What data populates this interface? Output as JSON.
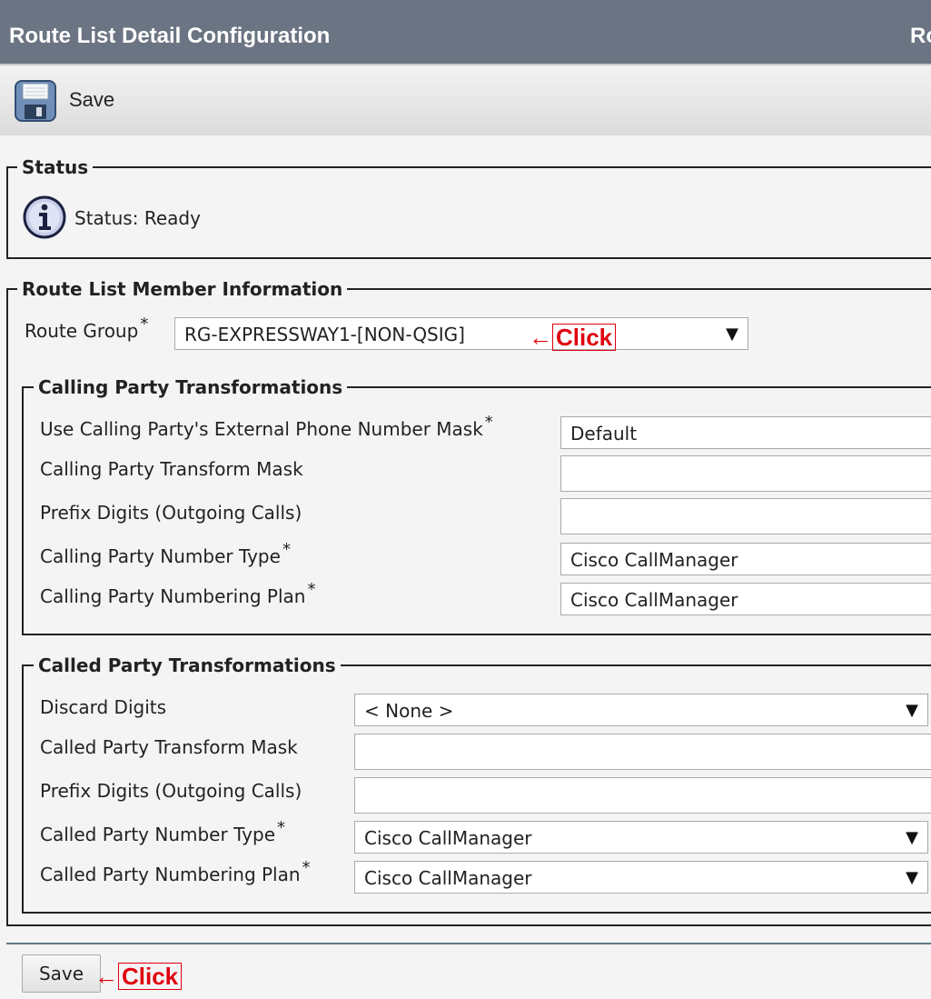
{
  "header": {
    "title": "Route List Detail Configuration",
    "right_text": "Ro"
  },
  "toolbar": {
    "save_label": "Save"
  },
  "status_section": {
    "legend": "Status",
    "text": "Status: Ready"
  },
  "member_section": {
    "legend": "Route List Member Information",
    "route_group": {
      "label": "Route Group",
      "required": "*",
      "value": "RG-EXPRESSWAY1-[NON-QSIG]"
    }
  },
  "calling_section": {
    "legend": "Calling Party Transformations",
    "fields": [
      {
        "label": "Use Calling Party's External Phone Number Mask",
        "required": "*",
        "value": "Default"
      },
      {
        "label": "Calling Party Transform Mask",
        "value": ""
      },
      {
        "label": "Prefix Digits (Outgoing Calls)",
        "value": ""
      },
      {
        "label": "Calling Party Number Type",
        "required": "*",
        "value": "Cisco CallManager"
      },
      {
        "label": "Calling Party Numbering Plan",
        "required": "*",
        "value": "Cisco CallManager"
      }
    ]
  },
  "called_section": {
    "legend": "Called Party Transformations",
    "fields": [
      {
        "label": "Discard Digits",
        "value": "< None >"
      },
      {
        "label": "Called Party Transform Mask",
        "value": ""
      },
      {
        "label": "Prefix Digits (Outgoing Calls)",
        "value": ""
      },
      {
        "label": "Called Party Number Type",
        "required": "*",
        "value": "Cisco CallManager"
      },
      {
        "label": "Called Party Numbering Plan",
        "required": "*",
        "value": "Cisco CallManager"
      }
    ]
  },
  "annotations": {
    "arrow": "←",
    "click_label": "Click"
  },
  "footer": {
    "save_label": "Save"
  },
  "icons": {
    "dropdown_arrow": "▼"
  },
  "colors": {
    "header_bg": "#6b7482",
    "annotation_red": "#e0000f"
  }
}
